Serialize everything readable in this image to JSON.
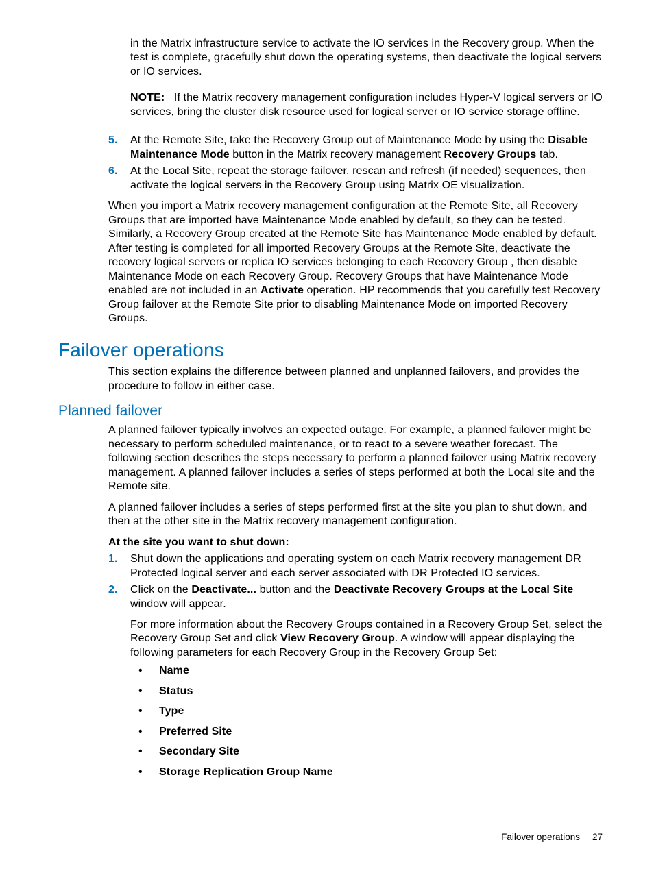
{
  "intro_para": "in the Matrix infrastructure service to activate the IO services in the Recovery group. When the test is complete, gracefully shut down the operating systems, then deactivate the logical servers or IO services.",
  "note": {
    "label": "NOTE:",
    "text": "If the Matrix recovery management configuration includes Hyper-V logical servers or IO services, bring the cluster disk resource used for logical server or IO service storage offline."
  },
  "step5": {
    "num": "5.",
    "t1": "At the Remote Site, take the Recovery Group out of Maintenance Mode by using the ",
    "b1": "Disable Maintenance Mode",
    "t2": " button in the Matrix recovery management ",
    "b2": "Recovery Groups",
    "t3": " tab."
  },
  "step6": {
    "num": "6.",
    "text": "At the Local Site, repeat the storage failover, rescan and refresh (if needed) sequences, then activate the logical servers in the Recovery Group using Matrix OE visualization."
  },
  "import_para": {
    "t1": "When you import a Matrix recovery management configuration at the Remote Site, all Recovery Groups that are imported have Maintenance Mode enabled by default, so they can be tested. Similarly, a Recovery Group created at the Remote Site has Maintenance Mode enabled by default. After testing is completed for all imported Recovery Groups at the Remote Site, deactivate the recovery logical servers or replica IO services belonging to each Recovery Group , then disable Maintenance Mode on each Recovery Group. Recovery Groups that have Maintenance Mode enabled are not included in an ",
    "b1": "Activate",
    "t2": " operation. HP recommends that you carefully test Recovery Group failover at the Remote Site prior to disabling Maintenance Mode on imported Recovery Groups."
  },
  "h1": "Failover operations",
  "h1_para": "This section explains the difference between planned and unplanned failovers, and provides the procedure to follow in either case.",
  "h2": "Planned failover",
  "h2_para1": "A planned failover typically involves an expected outage. For example, a planned failover might be necessary to perform scheduled maintenance, or to react to a severe weather forecast. The following section describes the steps necessary to perform a planned failover using Matrix recovery management. A planned failover includes a series of steps performed at both the Local site and the Remote site.",
  "h2_para2": "A planned failover includes a series of steps performed first at the site you plan to shut down, and then at the other site in the Matrix recovery management configuration.",
  "bold_lead": "At the site you want to shut down:",
  "pstep1": {
    "num": "1.",
    "text": "Shut down the applications and operating system on each Matrix recovery management DR Protected logical server and each server associated with DR Protected IO services."
  },
  "pstep2": {
    "num": "2.",
    "t1": "Click on the ",
    "b1": "Deactivate...",
    "t2": " button and the ",
    "b2": "Deactivate Recovery Groups at the Local Site",
    "t3": " window will appear.",
    "sub_t1": "For more information about the Recovery Groups contained in a Recovery Group Set, select the Recovery Group Set and click ",
    "sub_b1": "View Recovery Group",
    "sub_t2": ". A window will appear displaying the following parameters for each Recovery Group in the Recovery Group Set:"
  },
  "bullets": [
    "Name",
    "Status",
    "Type",
    "Preferred Site",
    "Secondary Site",
    "Storage Replication Group Name"
  ],
  "footer": {
    "section": "Failover operations",
    "page": "27"
  }
}
